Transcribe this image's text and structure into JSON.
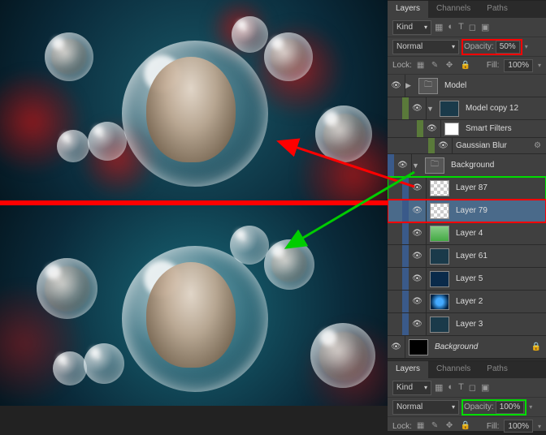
{
  "panel1": {
    "tabs": {
      "layers": "Layers",
      "channels": "Channels",
      "paths": "Paths"
    },
    "kind_label": "Kind",
    "blend_mode": "Normal",
    "opacity_label": "Opacity:",
    "opacity_value": "50%",
    "lock_label": "Lock:",
    "fill_label": "Fill:",
    "fill_value": "100%",
    "layers": [
      {
        "name": "Model",
        "type": "group",
        "visible": true
      },
      {
        "name": "Model copy 12",
        "type": "smart",
        "visible": true
      },
      {
        "name": "Smart Filters",
        "type": "filters-label",
        "visible": true
      },
      {
        "name": "Gaussian Blur",
        "type": "filter",
        "visible": true
      },
      {
        "name": "Background",
        "type": "group",
        "visible": true
      },
      {
        "name": "Layer 87",
        "type": "layer",
        "visible": true,
        "hl": "green",
        "thumb": "checker"
      },
      {
        "name": "Layer 79",
        "type": "layer",
        "visible": true,
        "hl": "red",
        "selected": true,
        "thumb": "checker"
      },
      {
        "name": "Layer 4",
        "type": "layer",
        "visible": true,
        "thumb": "green"
      },
      {
        "name": "Layer 61",
        "type": "layer",
        "visible": true,
        "thumb": "dark"
      },
      {
        "name": "Layer 5",
        "type": "layer",
        "visible": true,
        "thumb": "blue"
      },
      {
        "name": "Layer 2",
        "type": "layer",
        "visible": true,
        "thumb": "bluedot"
      },
      {
        "name": "Layer 3",
        "type": "layer",
        "visible": true,
        "thumb": "dark"
      },
      {
        "name": "Background",
        "type": "bg",
        "visible": true,
        "thumb": "black",
        "italic": true
      }
    ]
  },
  "panel2": {
    "tabs": {
      "layers": "Layers",
      "channels": "Channels",
      "paths": "Paths"
    },
    "kind_label": "Kind",
    "blend_mode": "Normal",
    "opacity_label": "Opacity:",
    "opacity_value": "100%",
    "lock_label": "Lock:",
    "fill_label": "Fill:",
    "fill_value": "100%"
  }
}
